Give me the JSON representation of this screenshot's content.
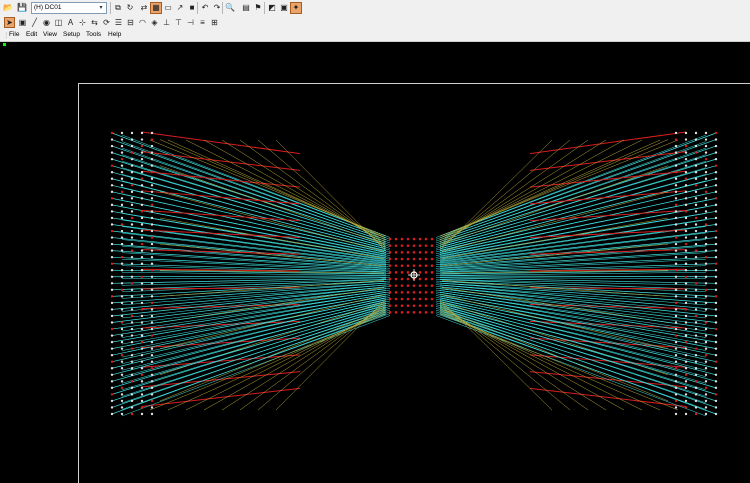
{
  "toolbar": {
    "layer_value": "(H) DC01",
    "icons": [
      "open-icon",
      "save-icon",
      "layer-dropdown",
      "copy-icon",
      "refresh-icon",
      "route-icon",
      "grid-icon",
      "display-icon",
      "place-icon",
      "lock-icon",
      "undo-icon",
      "redo-icon",
      "zoom-icon",
      "measure-icon",
      "flag-icon",
      "windows-icon",
      "print-icon",
      "settings-icon"
    ]
  },
  "menu": {
    "items": [
      {
        "label": "File"
      },
      {
        "label": "Edit"
      },
      {
        "label": "View"
      },
      {
        "label": "Setup"
      },
      {
        "label": "Tools"
      },
      {
        "label": "Help"
      }
    ]
  },
  "colors": {
    "background": "#000000",
    "trace_cyan": "#3fe0e0",
    "trace_red": "#d81d1d",
    "trace_olive": "#b6a83a",
    "board_outline": "#cfcfcf"
  }
}
